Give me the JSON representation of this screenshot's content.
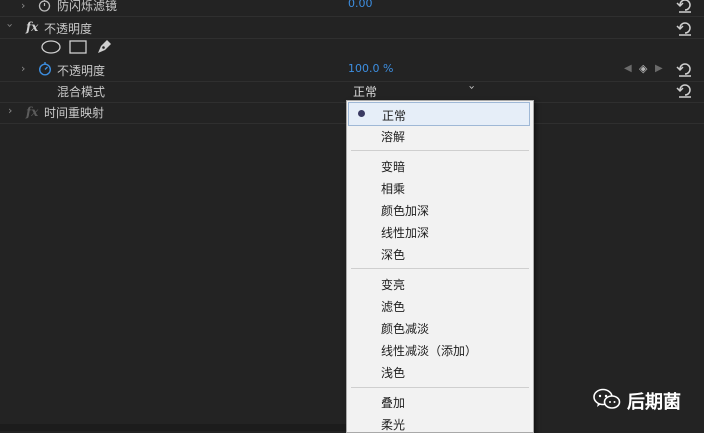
{
  "rows": {
    "antiflicker": {
      "label": "防闪烁滤镜",
      "value": "0.00"
    },
    "opacity_group": {
      "label": "不透明度",
      "fx": "fx"
    },
    "opacity": {
      "label": "不透明度",
      "value": "100.0 %"
    },
    "blend_mode": {
      "label": "混合模式",
      "value": "正常"
    },
    "time_remap": {
      "label": "时间重映射",
      "fx": "fx"
    }
  },
  "blend_menu": {
    "selected": "正常",
    "groups": [
      [
        "正常",
        "溶解"
      ],
      [
        "变暗",
        "相乘",
        "颜色加深",
        "线性加深",
        "深色"
      ],
      [
        "变亮",
        "滤色",
        "颜色减淡",
        "线性减淡（添加）",
        "浅色"
      ],
      [
        "叠加",
        "柔光"
      ]
    ]
  },
  "watermark": {
    "text": "后期菌"
  },
  "colors": {
    "accent_blue": "#3d8ee0",
    "panel_bg": "#232323",
    "menu_bg": "#f2f2f2"
  },
  "icons": [
    "chevron-right-icon",
    "chevron-down-icon",
    "stopwatch-icon",
    "ellipse-mask-icon",
    "rectangle-mask-icon",
    "pen-mask-icon",
    "reset-icon",
    "keyframe-prev-icon",
    "keyframe-add-icon",
    "keyframe-next-icon",
    "wechat-icon"
  ]
}
